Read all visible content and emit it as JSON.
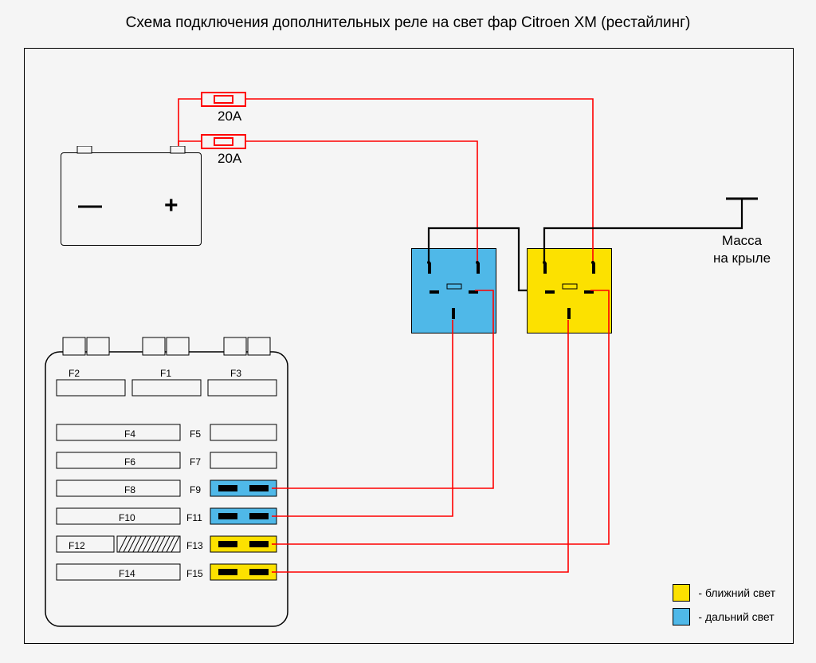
{
  "title": "Схема подключения дополнительных реле на свет фар Citroen XM (рестайлинг)",
  "fuse_rating_1": "20А",
  "fuse_rating_2": "20А",
  "ground_label_1": "Масса",
  "ground_label_2": "на крыле",
  "battery_minus": "—",
  "battery_plus": "+",
  "legend_near": "- ближний свет",
  "legend_far": "- дальний свет",
  "fusebox_labels": {
    "F1": "F1",
    "F2": "F2",
    "F3": "F3",
    "F4": "F4",
    "F5": "F5",
    "F6": "F6",
    "F7": "F7",
    "F8": "F8",
    "F9": "F9",
    "F10": "F10",
    "F11": "F11",
    "F12": "F12",
    "F13": "F13",
    "F14": "F14",
    "F15": "F15"
  },
  "colors": {
    "wire_red": "#ff0000",
    "wire_black": "#000000",
    "relay_far": "#4fb8e8",
    "relay_near": "#fce100"
  }
}
